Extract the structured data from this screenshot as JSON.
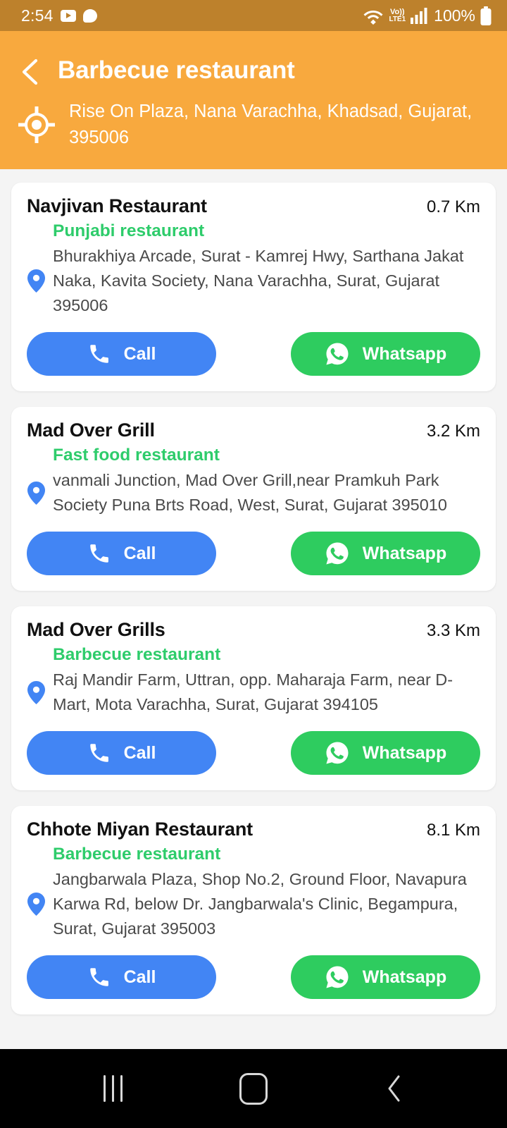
{
  "statusbar": {
    "time": "2:54",
    "icons_left": [
      "youtube-icon",
      "chat-bubble-icon"
    ],
    "network_label_top": "Vo))",
    "network_label_bottom": "LTE1",
    "battery_percent": "100%",
    "icons_right": [
      "wifi-icon",
      "volte-icon",
      "signal-bars-icon",
      "battery-icon"
    ],
    "background_color": "#BD812C"
  },
  "header": {
    "back_icon": "chevron-left-icon",
    "title": "Barbecue restaurant",
    "location_icon": "gps-crosshair-icon",
    "address": "Rise On Plaza, Nana Varachha, Khadsad, Gujarat, 395006",
    "background_color": "#F8A93E"
  },
  "colors": {
    "accent_orange": "#F8A93E",
    "call_blue": "#4285F4",
    "whatsapp_green": "#2ECC5F",
    "category_green": "#2ECC6B",
    "page_background": "#F4F4F4"
  },
  "actions": {
    "call_label": "Call",
    "call_icon": "phone-icon",
    "whatsapp_label": "Whatsapp",
    "whatsapp_icon": "whatsapp-icon"
  },
  "results": [
    {
      "name": "Navjivan Restaurant",
      "distance": "0.7 Km",
      "category": "Punjabi restaurant",
      "address": "Bhurakhiya Arcade, Surat - Kamrej Hwy, Sarthana Jakat Naka, Kavita Society, Nana Varachha, Surat, Gujarat 395006"
    },
    {
      "name": "Mad Over Grill",
      "distance": "3.2 Km",
      "category": "Fast food restaurant",
      "address": "vanmali Junction, Mad Over Grill,near Pramkuh Park Society Puna Brts Road, West, Surat, Gujarat 395010"
    },
    {
      "name": "Mad Over Grills",
      "distance": "3.3 Km",
      "category": "Barbecue restaurant",
      "address": "Raj Mandir Farm, Uttran, opp. Maharaja Farm, near D-Mart, Mota Varachha, Surat, Gujarat 394105"
    },
    {
      "name": "Chhote Miyan Restaurant",
      "distance": "8.1 Km",
      "category": "Barbecue restaurant",
      "address": "Jangbarwala Plaza, Shop No.2, Ground Floor, Navapura Karwa Rd, below Dr. Jangbarwala's Clinic, Begampura, Surat, Gujarat 395003"
    }
  ],
  "navbar": {
    "recents_icon": "recents-icon",
    "home_icon": "home-icon",
    "back_icon": "back-icon"
  }
}
